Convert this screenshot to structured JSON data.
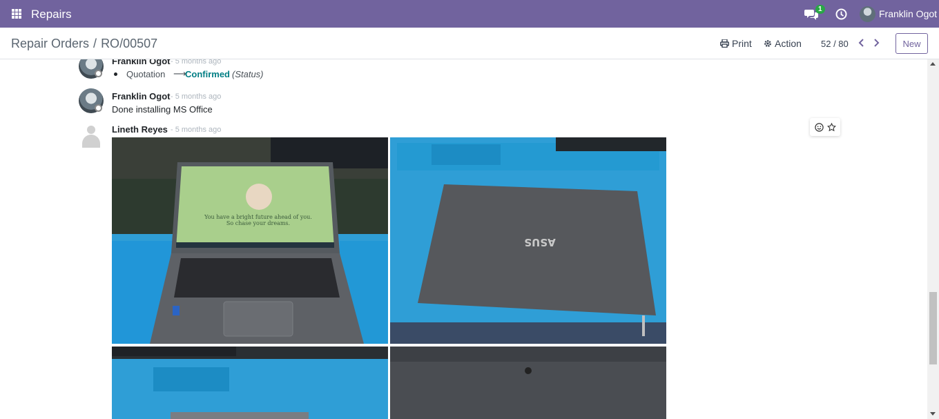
{
  "navbar": {
    "app_name": "Repairs",
    "chat_badge": "1",
    "user_name": "Franklin Ogot",
    "color": "#71639e"
  },
  "control": {
    "breadcrumb_parent": "Repair Orders",
    "breadcrumb_sep": "/",
    "breadcrumb_current": "RO/00507",
    "print_label": "Print",
    "action_label": "Action",
    "pager_value": "52 / 80",
    "new_label": "New"
  },
  "chatter": {
    "messages": [
      {
        "author": "Franklin Ogot",
        "date": "- 5 months ago",
        "tracking": {
          "old_value": "Quotation",
          "arrow": "⟶",
          "new_value": "Confirmed",
          "field": "(Status)"
        }
      },
      {
        "author": "Franklin Ogot",
        "date": "- 5 months ago",
        "body": "Done installing MS Office"
      },
      {
        "author": "Lineth Reyes",
        "date": "- 5 months ago",
        "attachments": [
          {
            "name": "laptop-open-photo",
            "screen_text_1": "You have a bright future ahead of you.",
            "screen_text_2": "So chase your dreams."
          },
          {
            "name": "laptop-closed-photo",
            "logo_text": "ASUS"
          },
          {
            "name": "laptop-bottom-photo"
          },
          {
            "name": "laptop-underside-photo"
          }
        ]
      }
    ]
  }
}
